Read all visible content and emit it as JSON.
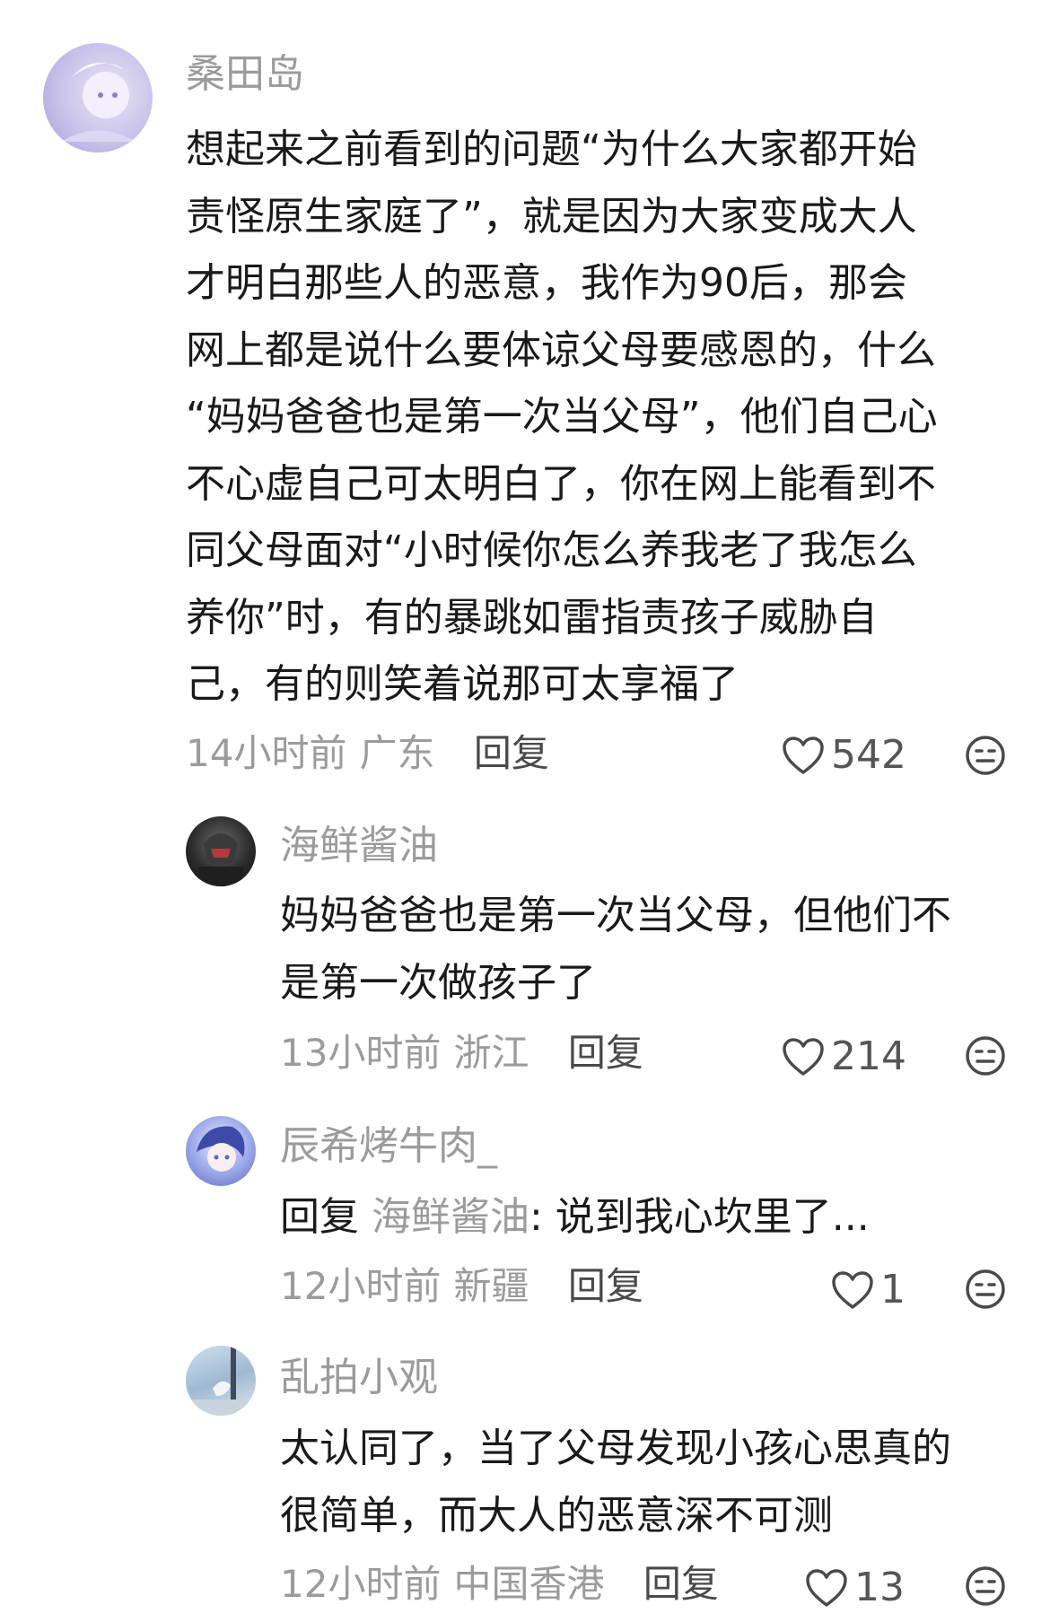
{
  "comments": [
    {
      "user": "桑田岛",
      "lines": [
        "想起来之前看到的问题“为什么大家都开始",
        "责怪原生家庭了”，就是因为大家变成大人",
        "才明白那些人的恶意，我作为90后，那会",
        "网上都是说什么要体谅父母要感恩的，什么",
        "“妈妈爸爸也是第一次当父母”，他们自己心",
        "不心虚自己可太明白了，你在网上能看到不",
        "同父母面对“小时候你怎么养我老了我怎么",
        "养你”时，有的暴跳如雷指责孩子威胁自",
        "己，有的则笑着说那可太享福了"
      ],
      "time": "14小时前",
      "location": "广东",
      "reply_label": "回复",
      "likes": "542"
    },
    {
      "user": "海鲜酱油",
      "lines": [
        "妈妈爸爸也是第一次当父母，但他们不",
        "是第一次做孩子了"
      ],
      "time": "13小时前",
      "location": "浙江",
      "reply_label": "回复",
      "likes": "214"
    },
    {
      "user": "辰希烤牛肉_",
      "reply_prefix": "回复",
      "reply_to": "海鲜酱油",
      "reply_text": ": 说到我心坎里了...",
      "time": "12小时前",
      "location": "新疆",
      "reply_label": "回复",
      "likes": "1"
    },
    {
      "user": "乱拍小观",
      "lines": [
        "太认同了，当了父母发现小孩心思真的",
        "很简单，而大人的恶意深不可测"
      ],
      "time": "12小时前",
      "location": "中国香港",
      "reply_label": "回复",
      "likes": "13"
    }
  ],
  "icons": {
    "like": "heart-outline-icon",
    "emoji": "neutral-face-icon"
  },
  "colors": {
    "text": "#1a1a1a",
    "secondary": "#9b9b9b"
  }
}
